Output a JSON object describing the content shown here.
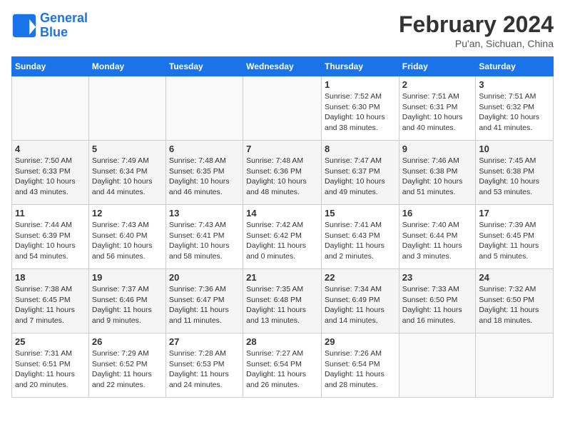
{
  "header": {
    "logo_line1": "General",
    "logo_line2": "Blue",
    "month_year": "February 2024",
    "location": "Pu'an, Sichuan, China"
  },
  "weekdays": [
    "Sunday",
    "Monday",
    "Tuesday",
    "Wednesday",
    "Thursday",
    "Friday",
    "Saturday"
  ],
  "weeks": [
    [
      {
        "day": "",
        "sunrise": "",
        "sunset": "",
        "daylight": ""
      },
      {
        "day": "",
        "sunrise": "",
        "sunset": "",
        "daylight": ""
      },
      {
        "day": "",
        "sunrise": "",
        "sunset": "",
        "daylight": ""
      },
      {
        "day": "",
        "sunrise": "",
        "sunset": "",
        "daylight": ""
      },
      {
        "day": "1",
        "sunrise": "Sunrise: 7:52 AM",
        "sunset": "Sunset: 6:30 PM",
        "daylight": "Daylight: 10 hours and 38 minutes."
      },
      {
        "day": "2",
        "sunrise": "Sunrise: 7:51 AM",
        "sunset": "Sunset: 6:31 PM",
        "daylight": "Daylight: 10 hours and 40 minutes."
      },
      {
        "day": "3",
        "sunrise": "Sunrise: 7:51 AM",
        "sunset": "Sunset: 6:32 PM",
        "daylight": "Daylight: 10 hours and 41 minutes."
      }
    ],
    [
      {
        "day": "4",
        "sunrise": "Sunrise: 7:50 AM",
        "sunset": "Sunset: 6:33 PM",
        "daylight": "Daylight: 10 hours and 43 minutes."
      },
      {
        "day": "5",
        "sunrise": "Sunrise: 7:49 AM",
        "sunset": "Sunset: 6:34 PM",
        "daylight": "Daylight: 10 hours and 44 minutes."
      },
      {
        "day": "6",
        "sunrise": "Sunrise: 7:48 AM",
        "sunset": "Sunset: 6:35 PM",
        "daylight": "Daylight: 10 hours and 46 minutes."
      },
      {
        "day": "7",
        "sunrise": "Sunrise: 7:48 AM",
        "sunset": "Sunset: 6:36 PM",
        "daylight": "Daylight: 10 hours and 48 minutes."
      },
      {
        "day": "8",
        "sunrise": "Sunrise: 7:47 AM",
        "sunset": "Sunset: 6:37 PM",
        "daylight": "Daylight: 10 hours and 49 minutes."
      },
      {
        "day": "9",
        "sunrise": "Sunrise: 7:46 AM",
        "sunset": "Sunset: 6:38 PM",
        "daylight": "Daylight: 10 hours and 51 minutes."
      },
      {
        "day": "10",
        "sunrise": "Sunrise: 7:45 AM",
        "sunset": "Sunset: 6:38 PM",
        "daylight": "Daylight: 10 hours and 53 minutes."
      }
    ],
    [
      {
        "day": "11",
        "sunrise": "Sunrise: 7:44 AM",
        "sunset": "Sunset: 6:39 PM",
        "daylight": "Daylight: 10 hours and 54 minutes."
      },
      {
        "day": "12",
        "sunrise": "Sunrise: 7:43 AM",
        "sunset": "Sunset: 6:40 PM",
        "daylight": "Daylight: 10 hours and 56 minutes."
      },
      {
        "day": "13",
        "sunrise": "Sunrise: 7:43 AM",
        "sunset": "Sunset: 6:41 PM",
        "daylight": "Daylight: 10 hours and 58 minutes."
      },
      {
        "day": "14",
        "sunrise": "Sunrise: 7:42 AM",
        "sunset": "Sunset: 6:42 PM",
        "daylight": "Daylight: 11 hours and 0 minutes."
      },
      {
        "day": "15",
        "sunrise": "Sunrise: 7:41 AM",
        "sunset": "Sunset: 6:43 PM",
        "daylight": "Daylight: 11 hours and 2 minutes."
      },
      {
        "day": "16",
        "sunrise": "Sunrise: 7:40 AM",
        "sunset": "Sunset: 6:44 PM",
        "daylight": "Daylight: 11 hours and 3 minutes."
      },
      {
        "day": "17",
        "sunrise": "Sunrise: 7:39 AM",
        "sunset": "Sunset: 6:45 PM",
        "daylight": "Daylight: 11 hours and 5 minutes."
      }
    ],
    [
      {
        "day": "18",
        "sunrise": "Sunrise: 7:38 AM",
        "sunset": "Sunset: 6:45 PM",
        "daylight": "Daylight: 11 hours and 7 minutes."
      },
      {
        "day": "19",
        "sunrise": "Sunrise: 7:37 AM",
        "sunset": "Sunset: 6:46 PM",
        "daylight": "Daylight: 11 hours and 9 minutes."
      },
      {
        "day": "20",
        "sunrise": "Sunrise: 7:36 AM",
        "sunset": "Sunset: 6:47 PM",
        "daylight": "Daylight: 11 hours and 11 minutes."
      },
      {
        "day": "21",
        "sunrise": "Sunrise: 7:35 AM",
        "sunset": "Sunset: 6:48 PM",
        "daylight": "Daylight: 11 hours and 13 minutes."
      },
      {
        "day": "22",
        "sunrise": "Sunrise: 7:34 AM",
        "sunset": "Sunset: 6:49 PM",
        "daylight": "Daylight: 11 hours and 14 minutes."
      },
      {
        "day": "23",
        "sunrise": "Sunrise: 7:33 AM",
        "sunset": "Sunset: 6:50 PM",
        "daylight": "Daylight: 11 hours and 16 minutes."
      },
      {
        "day": "24",
        "sunrise": "Sunrise: 7:32 AM",
        "sunset": "Sunset: 6:50 PM",
        "daylight": "Daylight: 11 hours and 18 minutes."
      }
    ],
    [
      {
        "day": "25",
        "sunrise": "Sunrise: 7:31 AM",
        "sunset": "Sunset: 6:51 PM",
        "daylight": "Daylight: 11 hours and 20 minutes."
      },
      {
        "day": "26",
        "sunrise": "Sunrise: 7:29 AM",
        "sunset": "Sunset: 6:52 PM",
        "daylight": "Daylight: 11 hours and 22 minutes."
      },
      {
        "day": "27",
        "sunrise": "Sunrise: 7:28 AM",
        "sunset": "Sunset: 6:53 PM",
        "daylight": "Daylight: 11 hours and 24 minutes."
      },
      {
        "day": "28",
        "sunrise": "Sunrise: 7:27 AM",
        "sunset": "Sunset: 6:54 PM",
        "daylight": "Daylight: 11 hours and 26 minutes."
      },
      {
        "day": "29",
        "sunrise": "Sunrise: 7:26 AM",
        "sunset": "Sunset: 6:54 PM",
        "daylight": "Daylight: 11 hours and 28 minutes."
      },
      {
        "day": "",
        "sunrise": "",
        "sunset": "",
        "daylight": ""
      },
      {
        "day": "",
        "sunrise": "",
        "sunset": "",
        "daylight": ""
      }
    ]
  ]
}
